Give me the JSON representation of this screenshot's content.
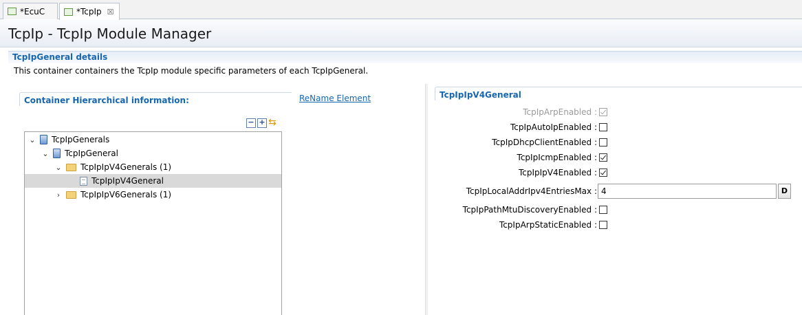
{
  "tabs": [
    {
      "label": "*EcuC",
      "active": false
    },
    {
      "label": "*TcpIp",
      "active": true,
      "close": "☒"
    }
  ],
  "header": {
    "title": "TcpIp - TcpIp Module Manager"
  },
  "details": {
    "title": "TcpIpGeneral details",
    "description": "This container containers the TcpIp module specific parameters of each TcpIpGeneral."
  },
  "left": {
    "section_title": "Container Hierarchical information:",
    "rename_link": "ReName Element",
    "toolbar": {
      "collapse": "−",
      "expand": "+",
      "link": "⇆"
    },
    "tree": [
      {
        "label": "TcpIpGenerals",
        "expander": "⌄"
      },
      {
        "label": "TcpIpGeneral",
        "expander": "⌄"
      },
      {
        "label": "TcpIpIpV4Generals (1)",
        "expander": "⌄"
      },
      {
        "label": "TcpIpIpV4General",
        "selected": true
      },
      {
        "label": "TcpIpIpV6Generals (1)",
        "expander": "›"
      }
    ]
  },
  "right": {
    "section_title": "TcpIpIpV4General",
    "fields": [
      {
        "label": "TcpIpArpEnabled :",
        "type": "checkbox",
        "checked": true,
        "disabled": true
      },
      {
        "label": "TcpIpAutoIpEnabled :",
        "type": "checkbox",
        "checked": false
      },
      {
        "label": "TcpIpDhcpClientEnabled :",
        "type": "checkbox",
        "checked": false
      },
      {
        "label": "TcpIpIcmpEnabled :",
        "type": "checkbox",
        "checked": true
      },
      {
        "label": "TcpIpIpV4Enabled :",
        "type": "checkbox",
        "checked": true
      },
      {
        "label": "TcpIpLocalAddrIpv4EntriesMax :",
        "type": "text",
        "value": "4",
        "button": "D"
      },
      {
        "label": "TcpIpPathMtuDiscoveryEnabled :",
        "type": "checkbox",
        "checked": false
      },
      {
        "label": "TcpIpArpStaticEnabled :",
        "type": "checkbox",
        "checked": false
      }
    ]
  }
}
